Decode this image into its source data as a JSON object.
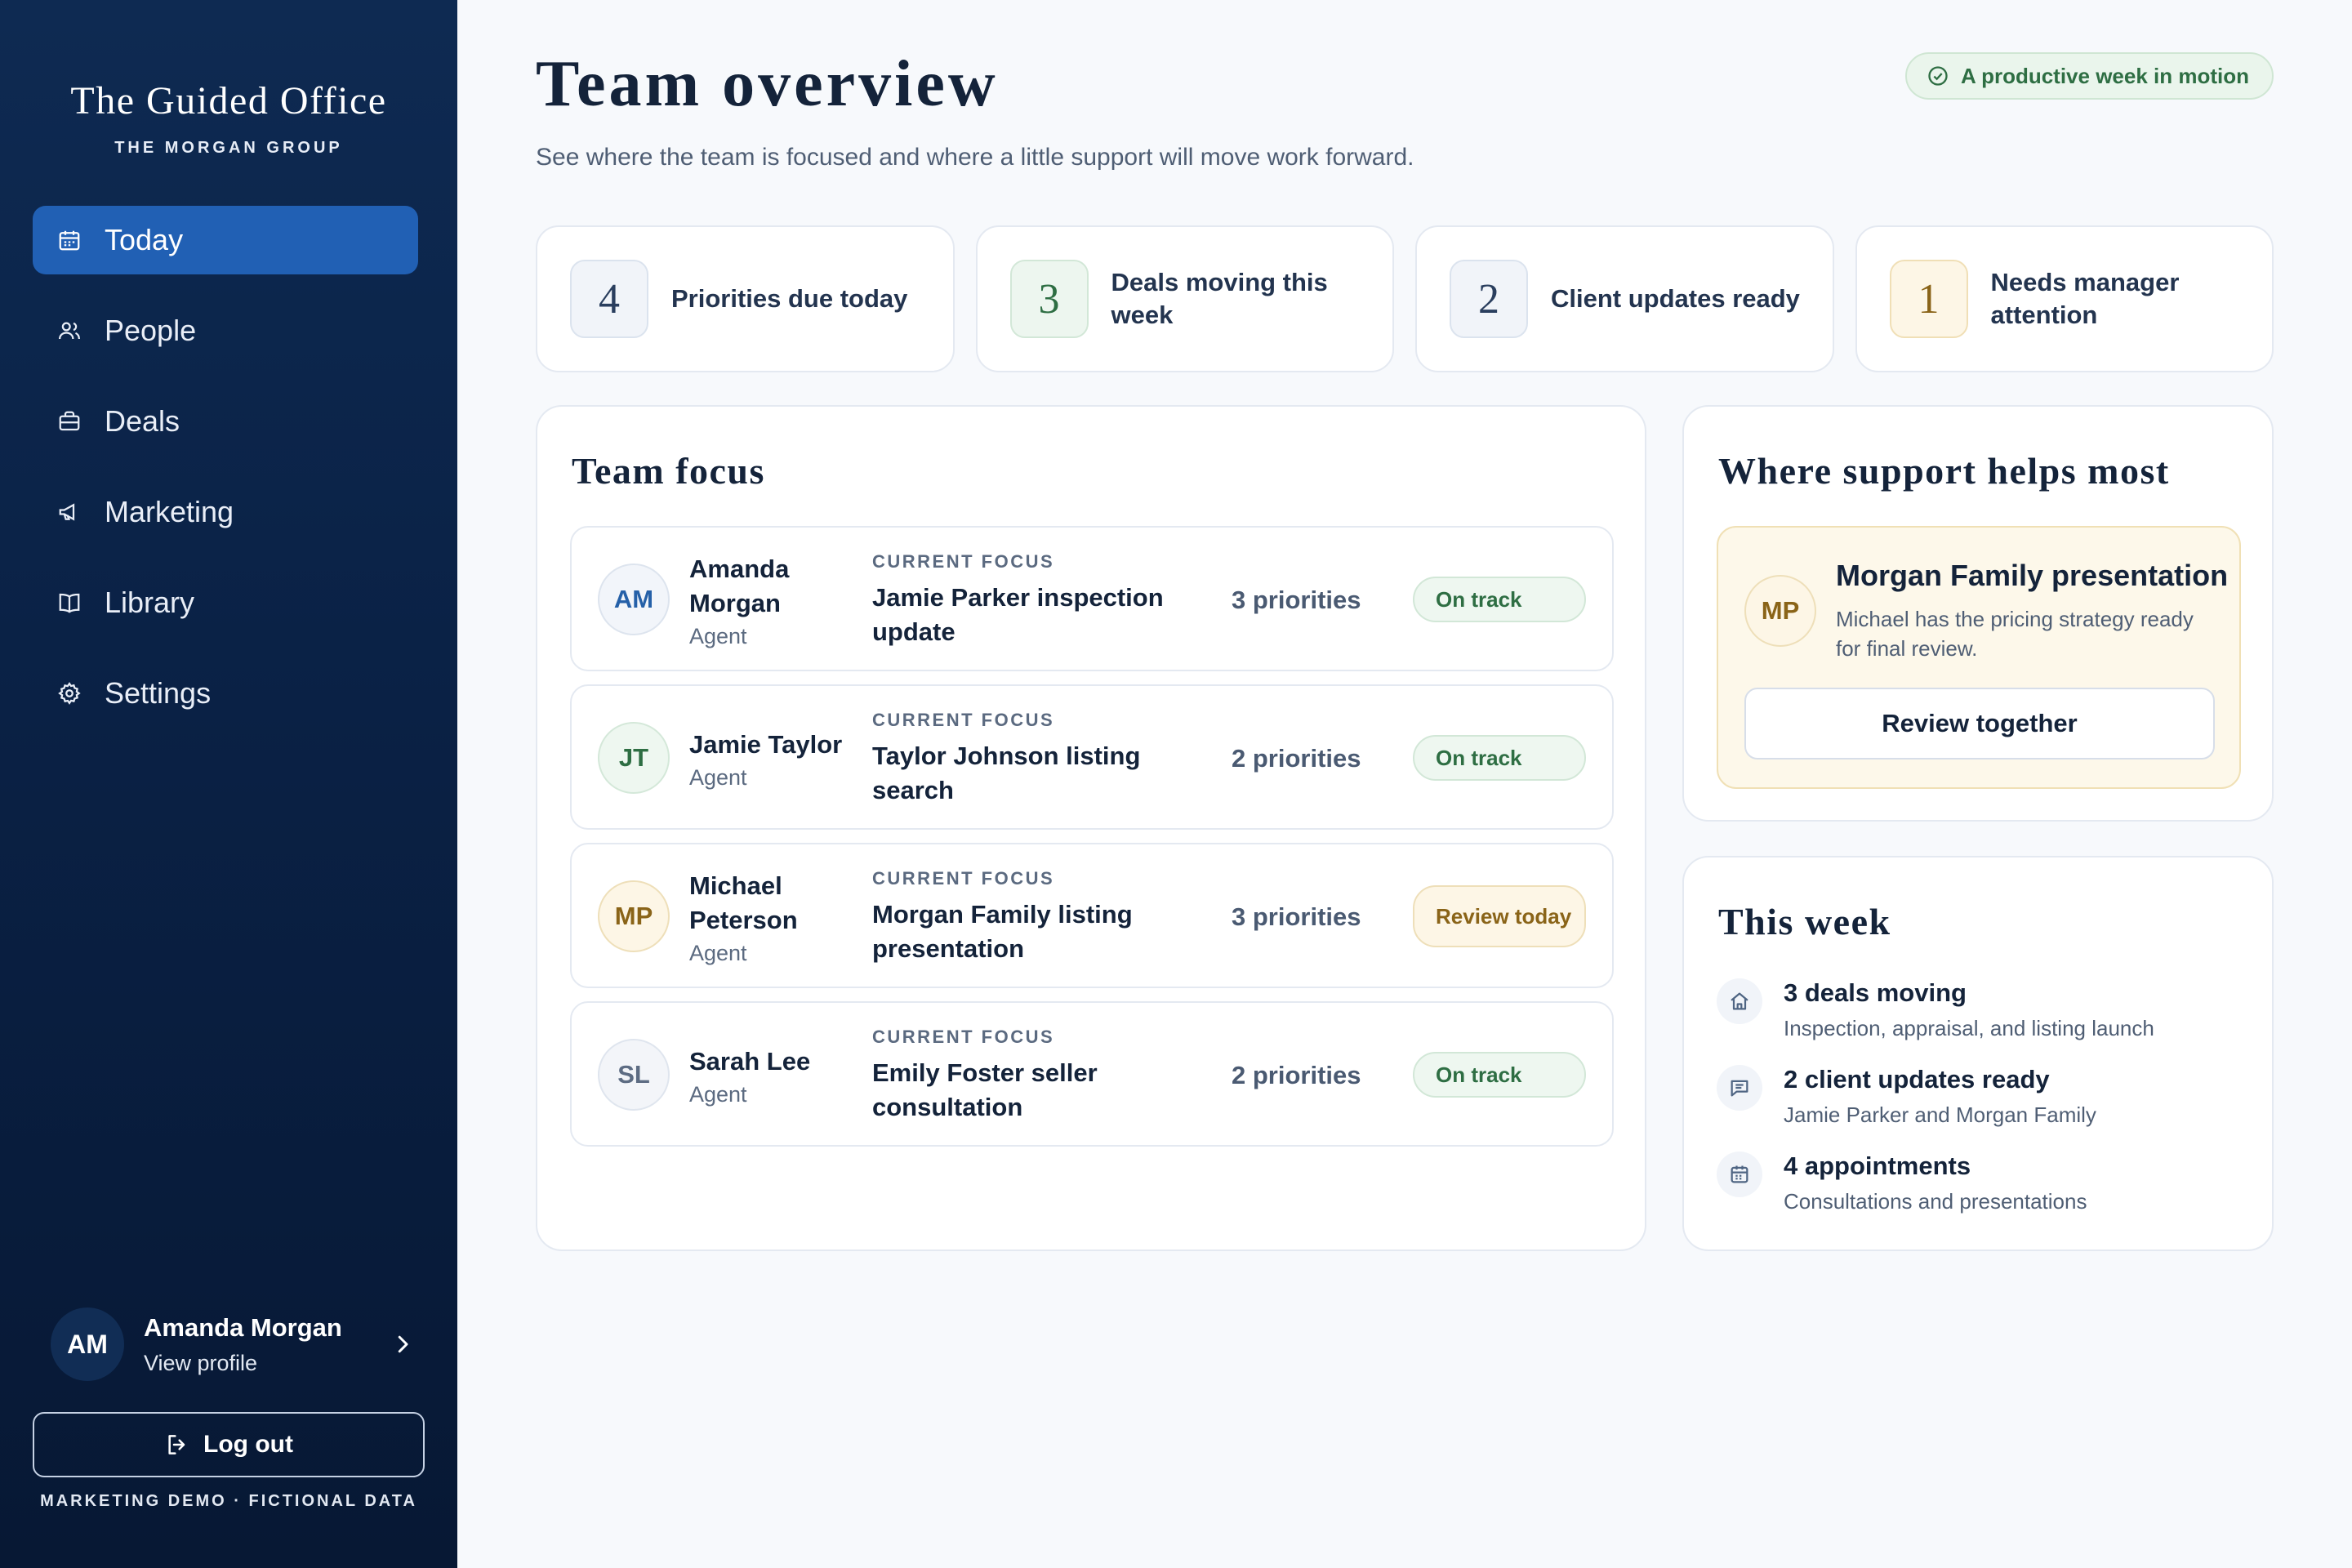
{
  "brand": {
    "title": "The Guided Office",
    "subtitle": "THE MORGAN GROUP"
  },
  "nav": [
    {
      "label": "Today",
      "icon": "calendar-icon",
      "active": true
    },
    {
      "label": "People",
      "icon": "people-icon"
    },
    {
      "label": "Deals",
      "icon": "briefcase-icon"
    },
    {
      "label": "Marketing",
      "icon": "megaphone-icon"
    },
    {
      "label": "Library",
      "icon": "book-icon"
    },
    {
      "label": "Settings",
      "icon": "gear-icon"
    }
  ],
  "profile": {
    "initials": "AM",
    "name": "Amanda Morgan",
    "link": "View profile"
  },
  "logout_label": "Log out",
  "demo_note": "MARKETING DEMO · FICTIONAL DATA",
  "header": {
    "title": "Team overview",
    "subtitle": "See where the team is focused and where a little support will move work forward.",
    "status_pill": "A productive week in motion"
  },
  "stats": [
    {
      "value": "4",
      "label": "Priorities due today"
    },
    {
      "value": "3",
      "label": "Deals moving this week"
    },
    {
      "value": "2",
      "label": "Client updates ready"
    },
    {
      "value": "1",
      "label": "Needs manager attention"
    }
  ],
  "team": {
    "title": "Team focus",
    "focus_label": "CURRENT FOCUS",
    "members": [
      {
        "initials": "AM",
        "name": "Amanda Morgan",
        "role": "Agent",
        "focus": "Jamie Parker inspection update",
        "priorities": "3 priorities",
        "status": "On track"
      },
      {
        "initials": "JT",
        "name": "Jamie Taylor",
        "role": "Agent",
        "focus": "Taylor Johnson listing search",
        "priorities": "2 priorities",
        "status": "On track"
      },
      {
        "initials": "MP",
        "name": "Michael Peterson",
        "role": "Agent",
        "focus": "Morgan Family listing presentation",
        "priorities": "3 priorities",
        "status": "Review today"
      },
      {
        "initials": "SL",
        "name": "Sarah Lee",
        "role": "Agent",
        "focus": "Emily Foster seller consultation",
        "priorities": "2 priorities",
        "status": "On track"
      }
    ]
  },
  "support": {
    "title": "Where support helps most",
    "initials": "MP",
    "callout_title": "Morgan Family presentation",
    "callout_text": "Michael has the pricing strategy ready for final review.",
    "button": "Review together"
  },
  "week": {
    "title": "This week",
    "items": [
      {
        "icon": "home-icon",
        "title": "3 deals moving",
        "text": "Inspection, appraisal, and listing launch"
      },
      {
        "icon": "chat-icon",
        "title": "2 client updates ready",
        "text": "Jamie Parker and Morgan Family"
      },
      {
        "icon": "calendar-icon",
        "title": "4 appointments",
        "text": "Consultations and presentations"
      }
    ]
  },
  "colors": {
    "sidebar": "#0a2145",
    "accent": "#2160b4",
    "success": "#2e6e43",
    "warning": "#8a6418"
  }
}
